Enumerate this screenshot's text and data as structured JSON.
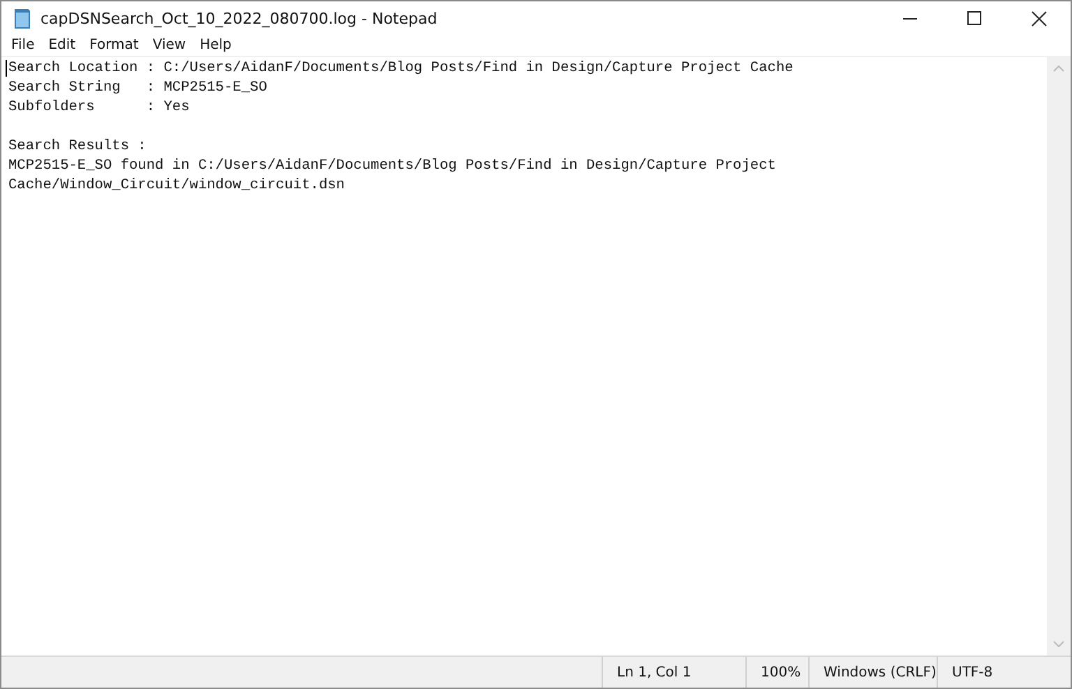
{
  "window": {
    "title": "capDSNSearch_Oct_10_2022_080700.log - Notepad"
  },
  "menu": [
    "File",
    "Edit",
    "Format",
    "View",
    "Help"
  ],
  "document": {
    "blocks": [
      [
        "Search Location : C:/Users/AidanF/Documents/Blog Posts/Find in Design/Capture Project Cache",
        "Search String   : MCP2515-E_SO",
        "Subfolders      : Yes"
      ],
      [
        "Search Results :",
        "MCP2515-E_SO found in C:/Users/AidanF/Documents/Blog Posts/Find in Design/Capture Project",
        "Cache/Window_Circuit/window_circuit.dsn"
      ]
    ]
  },
  "status_bar": [
    "Ln 1, Col 1",
    "100%",
    "Windows (CRLF)",
    "UTF-8"
  ]
}
